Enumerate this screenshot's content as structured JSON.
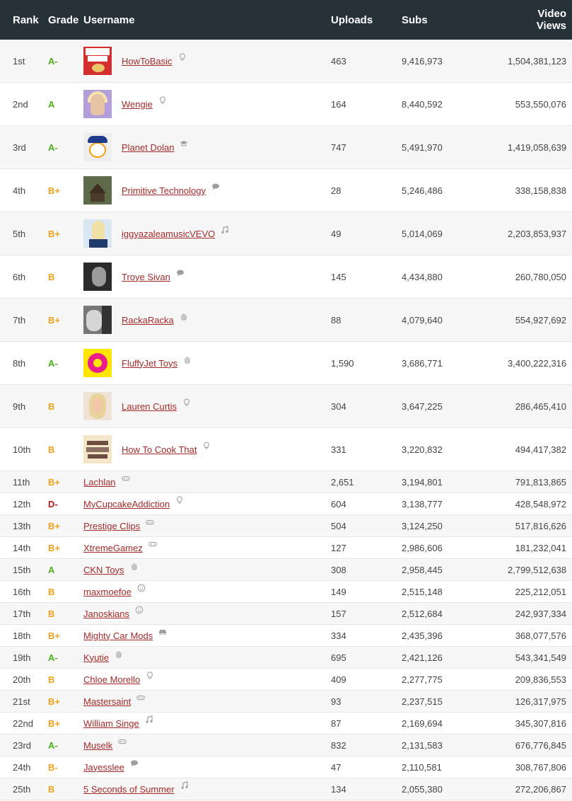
{
  "header": {
    "rank": "Rank",
    "grade": "Grade",
    "username": "Username",
    "uploads": "Uploads",
    "subs": "Subs",
    "views": "Video Views"
  },
  "colors": {
    "grade_green": "#4caf1a",
    "grade_orange": "#f0a21a",
    "grade_red": "#b71c1c",
    "link": "#a52a2a",
    "header_bg": "#263238"
  },
  "rows": [
    {
      "rank": "1st",
      "grade": "A-",
      "grade_color": "#4caf1a",
      "username": "HowToBasic",
      "icon": "lightbulb-icon",
      "uploads": "463",
      "subs": "9,416,973",
      "views": "1,504,381,123",
      "avatar": "howto"
    },
    {
      "rank": "2nd",
      "grade": "A",
      "grade_color": "#4caf1a",
      "username": "Wengie",
      "icon": "lightbulb-icon",
      "uploads": "164",
      "subs": "8,440,592",
      "views": "553,550,076",
      "avatar": "wengie"
    },
    {
      "rank": "3rd",
      "grade": "A-",
      "grade_color": "#4caf1a",
      "username": "Planet Dolan",
      "icon": "graduation-cap-icon",
      "uploads": "747",
      "subs": "5,491,970",
      "views": "1,419,058,639",
      "avatar": "dolan"
    },
    {
      "rank": "4th",
      "grade": "B+",
      "grade_color": "#f0a21a",
      "username": "Primitive Technology",
      "icon": "chat-bubble-icon",
      "uploads": "28",
      "subs": "5,246,486",
      "views": "338,158,838",
      "avatar": "primitive"
    },
    {
      "rank": "5th",
      "grade": "B+",
      "grade_color": "#f0a21a",
      "username": "iggyazaleamusicVEVO",
      "icon": "music-note-icon",
      "uploads": "49",
      "subs": "5,014,069",
      "views": "2,203,853,937",
      "avatar": "iggy"
    },
    {
      "rank": "6th",
      "grade": "B",
      "grade_color": "#f0a21a",
      "username": "Troye Sivan",
      "icon": "chat-bubble-icon",
      "uploads": "145",
      "subs": "4,434,880",
      "views": "260,780,050",
      "avatar": "troye"
    },
    {
      "rank": "7th",
      "grade": "B+",
      "grade_color": "#f0a21a",
      "username": "RackaRacka",
      "icon": "hand-icon",
      "uploads": "88",
      "subs": "4,079,640",
      "views": "554,927,692",
      "avatar": "racka"
    },
    {
      "rank": "8th",
      "grade": "A-",
      "grade_color": "#4caf1a",
      "username": "FluffyJet Toys",
      "icon": "hand-icon",
      "uploads": "1,590",
      "subs": "3,686,771",
      "views": "3,400,222,316",
      "avatar": "fluffy"
    },
    {
      "rank": "9th",
      "grade": "B",
      "grade_color": "#f0a21a",
      "username": "Lauren Curtis",
      "icon": "lightbulb-icon",
      "uploads": "304",
      "subs": "3,647,225",
      "views": "286,465,410",
      "avatar": "lauren"
    },
    {
      "rank": "10th",
      "grade": "B",
      "grade_color": "#f0a21a",
      "username": "How To Cook That",
      "icon": "lightbulb-icon",
      "uploads": "331",
      "subs": "3,220,832",
      "views": "494,417,382",
      "avatar": "cook"
    },
    {
      "rank": "11th",
      "grade": "B+",
      "grade_color": "#f0a21a",
      "username": "Lachlan",
      "icon": "gamepad-icon",
      "uploads": "2,651",
      "subs": "3,194,801",
      "views": "791,813,865"
    },
    {
      "rank": "12th",
      "grade": "D-",
      "grade_color": "#b71c1c",
      "username": "MyCupcakeAddiction",
      "icon": "lightbulb-icon",
      "uploads": "604",
      "subs": "3,138,777",
      "views": "428,548,972"
    },
    {
      "rank": "13th",
      "grade": "B+",
      "grade_color": "#f0a21a",
      "username": "Prestige Clips",
      "icon": "gamepad-icon",
      "uploads": "504",
      "subs": "3,124,250",
      "views": "517,816,626"
    },
    {
      "rank": "14th",
      "grade": "B+",
      "grade_color": "#f0a21a",
      "username": "XtremeGamez",
      "icon": "gamepad-icon",
      "uploads": "127",
      "subs": "2,986,606",
      "views": "181,232,041"
    },
    {
      "rank": "15th",
      "grade": "A",
      "grade_color": "#4caf1a",
      "username": "CKN Toys",
      "icon": "hand-icon",
      "uploads": "308",
      "subs": "2,958,445",
      "views": "2,799,512,638"
    },
    {
      "rank": "16th",
      "grade": "B",
      "grade_color": "#f0a21a",
      "username": "maxmoefoe",
      "icon": "smiley-icon",
      "uploads": "149",
      "subs": "2,515,148",
      "views": "225,212,051"
    },
    {
      "rank": "17th",
      "grade": "B",
      "grade_color": "#f0a21a",
      "username": "Janoskians",
      "icon": "smiley-icon",
      "uploads": "157",
      "subs": "2,512,684",
      "views": "242,937,334"
    },
    {
      "rank": "18th",
      "grade": "B+",
      "grade_color": "#f0a21a",
      "username": "Mighty Car Mods",
      "icon": "car-icon",
      "uploads": "334",
      "subs": "2,435,396",
      "views": "368,077,576"
    },
    {
      "rank": "19th",
      "grade": "A-",
      "grade_color": "#4caf1a",
      "username": "Kyutie",
      "icon": "hand-icon",
      "uploads": "695",
      "subs": "2,421,126",
      "views": "543,341,549"
    },
    {
      "rank": "20th",
      "grade": "B",
      "grade_color": "#f0a21a",
      "username": "Chloe Morello",
      "icon": "lightbulb-icon",
      "uploads": "409",
      "subs": "2,277,775",
      "views": "209,836,553"
    },
    {
      "rank": "21st",
      "grade": "B+",
      "grade_color": "#f0a21a",
      "username": "Mastersaint",
      "icon": "gamepad-icon",
      "uploads": "93",
      "subs": "2,237,515",
      "views": "126,317,975"
    },
    {
      "rank": "22nd",
      "grade": "B+",
      "grade_color": "#f0a21a",
      "username": "William Singe",
      "icon": "music-note-icon",
      "uploads": "87",
      "subs": "2,169,694",
      "views": "345,307,816"
    },
    {
      "rank": "23rd",
      "grade": "A-",
      "grade_color": "#4caf1a",
      "username": "Muselk",
      "icon": "gamepad-icon",
      "uploads": "832",
      "subs": "2,131,583",
      "views": "676,776,845"
    },
    {
      "rank": "24th",
      "grade": "B-",
      "grade_color": "#f0a21a",
      "username": "Jayesslee",
      "icon": "chat-bubble-icon",
      "uploads": "47",
      "subs": "2,110,581",
      "views": "308,767,806"
    },
    {
      "rank": "25th",
      "grade": "B",
      "grade_color": "#f0a21a",
      "username": "5 Seconds of Summer",
      "icon": "music-note-icon",
      "uploads": "134",
      "subs": "2,055,380",
      "views": "272,206,867"
    }
  ]
}
